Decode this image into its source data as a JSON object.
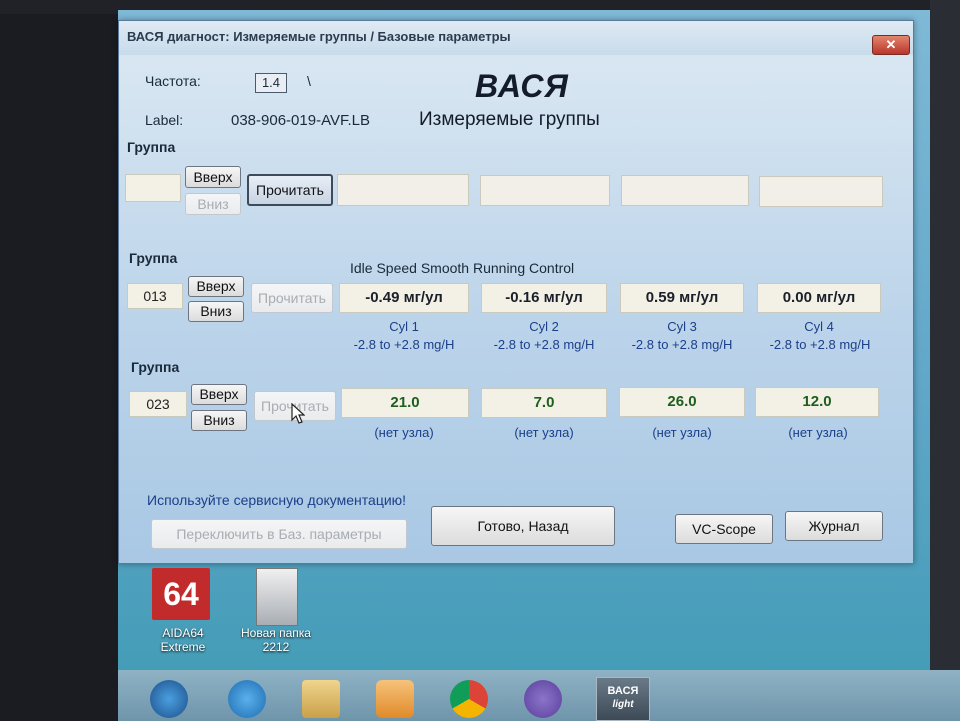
{
  "window": {
    "title": "ВАСЯ диагност: Измеряемые группы / Базовые параметры",
    "close_glyph": "✕"
  },
  "header": {
    "freq_label": "Частота:",
    "freq_value": "1.4",
    "freq_tick": "\\",
    "label_label": "Label:",
    "label_value": "038-906-019-AVF.LB",
    "logo": "ВАСЯ",
    "subtitle": "Измеряемые группы"
  },
  "group1": {
    "label": "Группа",
    "number": "",
    "up": "Вверх",
    "down": "Вниз",
    "read": "Прочитать",
    "fields": [
      "",
      "",
      "",
      ""
    ]
  },
  "group2": {
    "label": "Группа",
    "number": "013",
    "up": "Вверх",
    "down": "Вниз",
    "read": "Прочитать",
    "title": "Idle Speed Smooth Running Control",
    "values": [
      "-0.49 мг/ул",
      "-0.16 мг/ул",
      "0.59 мг/ул",
      "0.00 мг/ул"
    ],
    "captions": [
      "Cyl 1",
      "Cyl 2",
      "Cyl 3",
      "Cyl 4"
    ],
    "ranges": [
      "-2.8 to +2.8 mg/H",
      "-2.8 to +2.8 mg/H",
      "-2.8 to +2.8 mg/H",
      "-2.8 to +2.8 mg/H"
    ]
  },
  "group3": {
    "label": "Группа",
    "number": "023",
    "up": "Вверх",
    "down": "Вниз",
    "read": "Прочитать",
    "values": [
      "21.0",
      "7.0",
      "26.0",
      "12.0"
    ],
    "captions": [
      "(нет узла)",
      "(нет узла)",
      "(нет узла)",
      "(нет узла)"
    ]
  },
  "footer": {
    "note": "Используйте сервисную документацию!",
    "switch": "Переключить в Баз. параметры",
    "done": "Готово, Назад",
    "scope": "VC-Scope",
    "log": "Журнал"
  },
  "desktop": {
    "icon1_title": "AIDA64",
    "icon1_sub": "Extreme",
    "icon1_glyph": "64",
    "icon2_title": "Новая папка",
    "icon2_sub": "2212"
  },
  "taskbar": {
    "vasya_line1": "ВАСЯ",
    "vasya_line2": "light"
  },
  "colors": {
    "value_green": "#1d5e1d",
    "caption_blue": "#1c3f8a",
    "window_bg": "#bcd4ea",
    "close_red": "#b9352b"
  },
  "icons": [
    "close-icon",
    "aida64-icon",
    "folder-icon",
    "start-orb-icon",
    "ie-icon",
    "explorer-icon",
    "media-icon",
    "chrome-icon",
    "viber-icon",
    "vasya-icon"
  ]
}
